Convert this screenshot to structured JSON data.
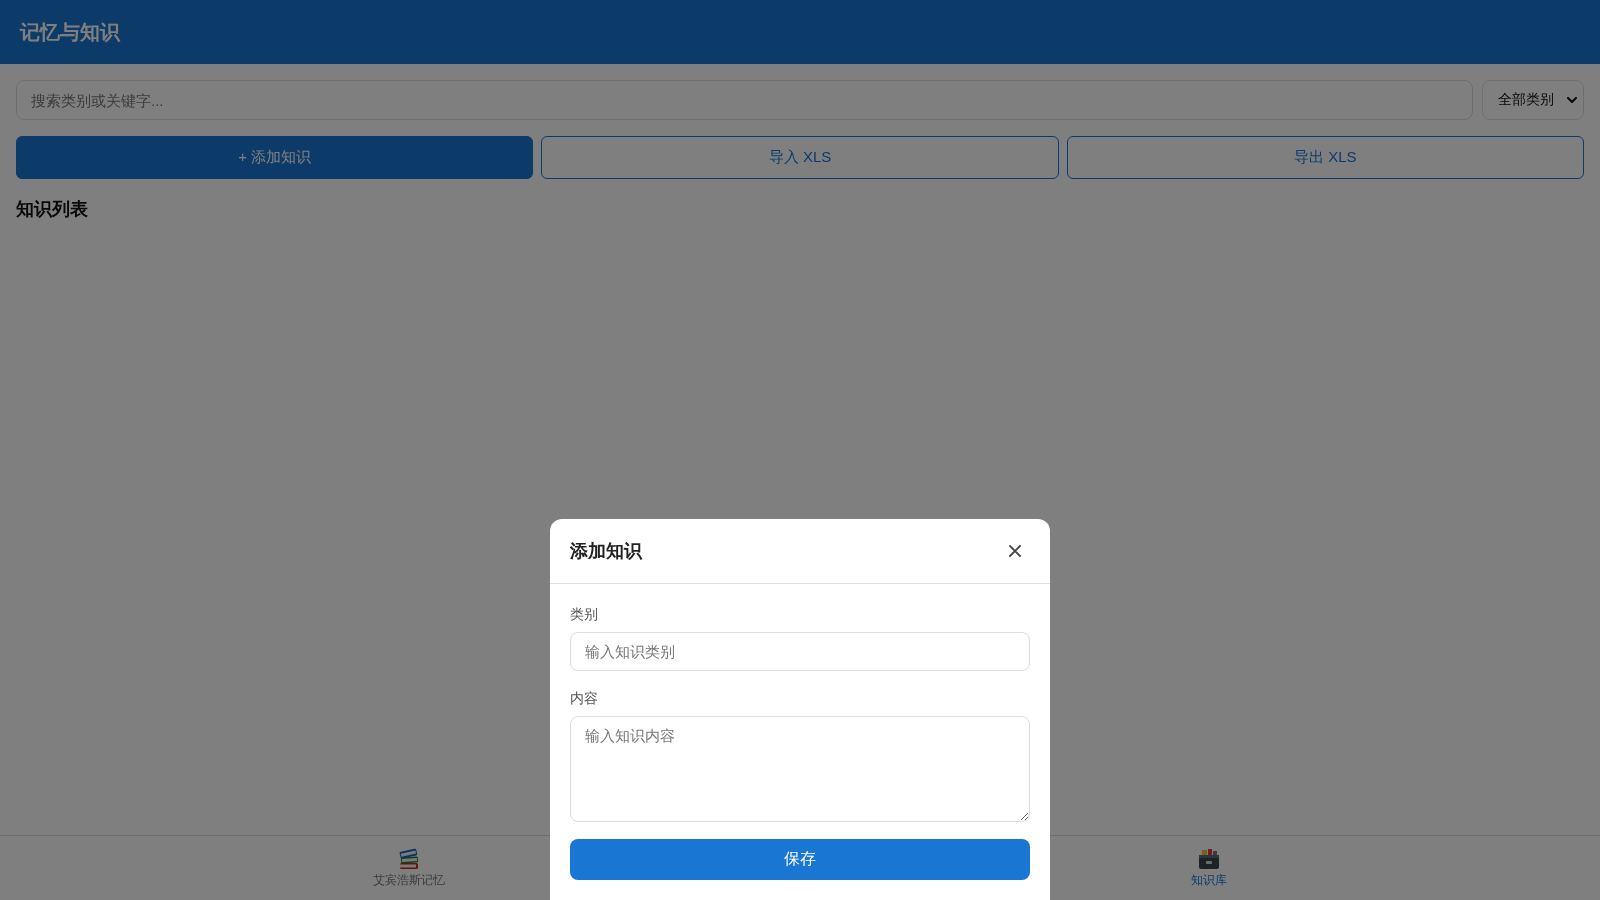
{
  "header": {
    "title": "记忆与知识"
  },
  "toolbar": {
    "search": {
      "placeholder": "搜索类别或关键字..."
    },
    "category_filter": {
      "value": "全部类别"
    }
  },
  "actions": [
    {
      "label": "+ 添加知识",
      "kind": "primary"
    },
    {
      "label": "导入 XLS",
      "kind": "outline"
    },
    {
      "label": "导出 XLS",
      "kind": "outline"
    }
  ],
  "list": {
    "title": "知识列表"
  },
  "bottom_nav": [
    {
      "label": "艾宾浩斯记忆",
      "selected": false
    },
    {
      "label": "知识库",
      "selected": true
    }
  ],
  "modal": {
    "title": "添加知识",
    "fields": [
      {
        "label": "类别",
        "placeholder": "输入知识类别",
        "kind": "input"
      },
      {
        "label": "内容",
        "placeholder": "输入知识内容",
        "kind": "textarea"
      }
    ],
    "submit": "保存"
  }
}
